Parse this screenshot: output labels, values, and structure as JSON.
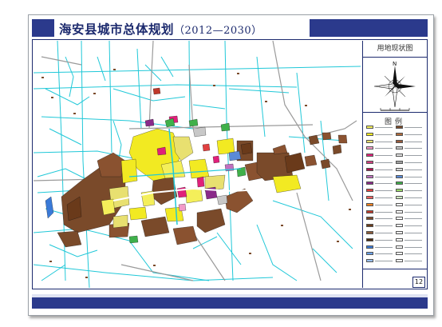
{
  "sheet": {
    "title_cn": "海安县城市总体规划",
    "title_years": "（2012—2030）",
    "panel_title": "用地现状图",
    "compass_label": "N",
    "legend_title": "图例",
    "page_number": "12"
  },
  "colors": {
    "band": "#2b3a8c",
    "frame": "#1c2a6e",
    "residential": "#f2ea22",
    "industrial": "#7a4a2a",
    "road": "#20c8d8",
    "commercial": "#e0207a",
    "green": "#3fb04a",
    "public": "#8a2a8a",
    "water": "#3a7ad8"
  },
  "legend_swatches": [
    "#f4ef5a",
    "#7a4a2a",
    "#f2ea22",
    "#b06a3a",
    "#e8e070",
    "#9a5a3a",
    "#f29ac8",
    "#c8c8c8",
    "#e0207a",
    "#e0e0e0",
    "#d04080",
    "#a0a0a0",
    "#b01050",
    "#d8d8d8",
    "#c070c0",
    "#5a8ad8",
    "#8a2a8a",
    "#3fb04a",
    "#e04040",
    "#9ad86a",
    "#ff6060",
    "#d0e8c0",
    "#f08020",
    "#ffffff",
    "#c0392b",
    "#ffffff",
    "#7a4a2a",
    "#ffffff",
    "#6a3a1a",
    "#ffffff",
    "#8a5a3a",
    "#f0f0f0",
    "#4a2a10",
    "#ffffff",
    "#3a7ad8",
    "#ffffff",
    "#6aa0e8",
    "#ffffff",
    "#9ac0f0",
    "#ffffff"
  ]
}
